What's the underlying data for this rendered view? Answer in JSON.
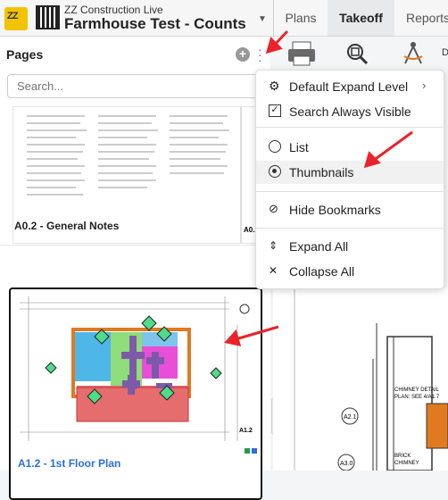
{
  "header": {
    "org": "ZZ Construction Live",
    "project": "Farmhouse Test - Counts",
    "tabs": [
      "Plans",
      "Takeoff",
      "Reports"
    ],
    "logo_text": "ZZ"
  },
  "pages": {
    "title": "Pages",
    "search_placeholder": "Search...",
    "items": [
      {
        "sheet": "A0.2",
        "label": "A0.2 - General Notes"
      },
      {
        "sheet": "A1.2",
        "label": "A1.2 - 1st Floor Plan"
      }
    ]
  },
  "menu": {
    "items": [
      {
        "label": "Default Expand Level",
        "icon": "gear-icon"
      },
      {
        "label": "Search Always Visible",
        "icon": "checkbox-checked-icon"
      },
      {
        "label": "List",
        "icon": "radio-empty-icon"
      },
      {
        "label": "Thumbnails",
        "icon": "radio-selected-icon"
      },
      {
        "label": "Hide Bookmarks",
        "icon": "eye-off-icon"
      },
      {
        "label": "Expand All",
        "icon": "expand-icon"
      },
      {
        "label": "Collapse All",
        "icon": "collapse-icon"
      }
    ]
  },
  "drawing": {
    "note": "CHIMNEY DETAIL\nPLAN: SEE 4/A1.7",
    "brick": "BRICK\nCHIMNEY",
    "ref1": "A2.1",
    "ref2": "A3.0",
    "letter": "D"
  },
  "colors": {
    "accent": "#2a6fdb",
    "annotation_arrow": "#e8242a",
    "thumbnail_border": "#111111"
  }
}
